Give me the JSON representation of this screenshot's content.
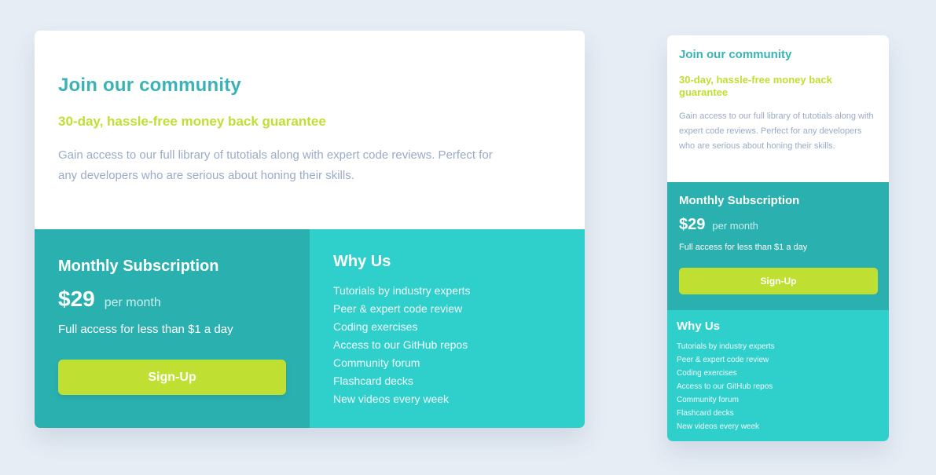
{
  "desktop": {
    "title": "Join our community",
    "subtitle": "30-day, hassle-free money back guarantee",
    "description": "Gain access to our full library of tutotials along with expert code reviews. Perfect for any developers who are serious about honing their skills.",
    "subscription": {
      "title": "Monthly Subscription",
      "price": "$29",
      "per": "per month",
      "access": "Full access for less than $1 a day",
      "button_label": "Sign-Up"
    },
    "why": {
      "title": "Why Us",
      "items": [
        "Tutorials by industry experts",
        "Peer & expert code review",
        "Coding exercises",
        "Access to our GitHub repos",
        "Community forum",
        "Flashcard decks",
        "New videos every week"
      ]
    }
  },
  "mobile": {
    "title": "Join our community",
    "subtitle": "30-day, hassle-free money back guarantee",
    "description": "Gain access to our full library of tutotials along with expert code reviews. Perfect for any developers who are serious about honing their skills.",
    "subscription": {
      "title": "Monthly Subscription",
      "price": "$29",
      "per": "per month",
      "access": "Full access for less than $1 a day",
      "button_label": "Sign-Up"
    },
    "why": {
      "title": "Why Us",
      "items": [
        "Tutorials by industry experts",
        "Peer & expert code review",
        "Coding exercises",
        "Access to our GitHub repos",
        "Community forum",
        "Flashcard decks",
        "New videos every week"
      ]
    }
  },
  "colors": {
    "background": "#e6edf5",
    "title": "#3bb2b5",
    "accent_lime": "#bfdf32",
    "text_muted": "#9aabc7",
    "panel_dark_teal": "#2bb0b0",
    "panel_light_teal": "#2fcfcb"
  }
}
